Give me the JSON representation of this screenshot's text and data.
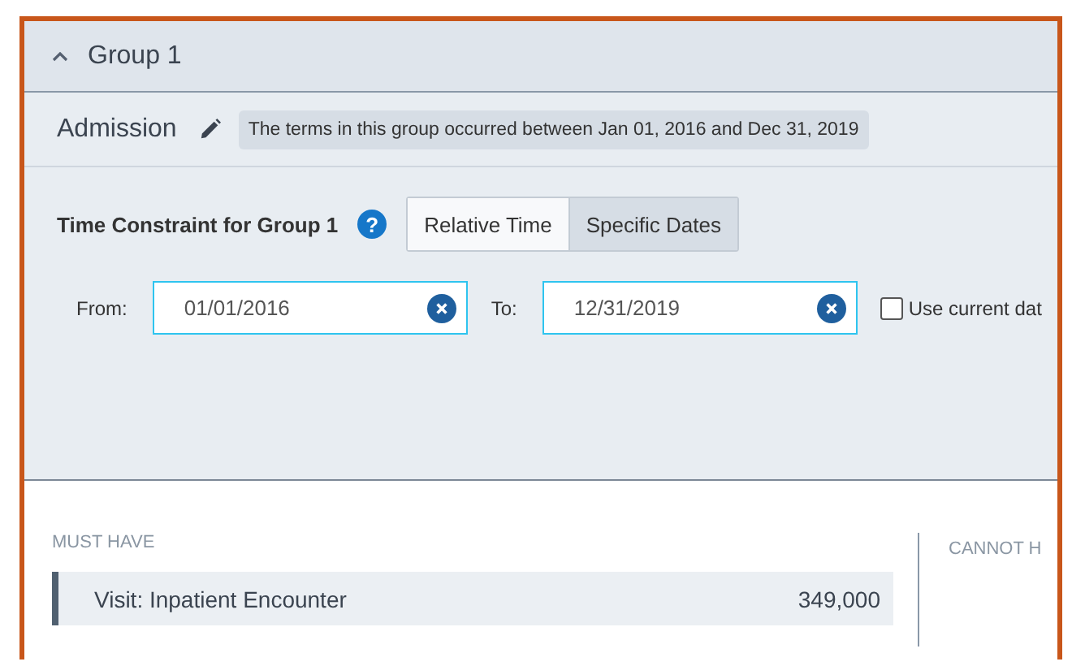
{
  "group": {
    "title": "Group 1",
    "expanded": true
  },
  "admission": {
    "label": "Admission",
    "summary": "The terms in this group occurred between Jan 01, 2016 and Dec 31, 2019"
  },
  "time_constraint": {
    "label": "Time Constraint for Group 1",
    "help": "?",
    "modes": [
      {
        "label": "Relative Time",
        "selected": false
      },
      {
        "label": "Specific Dates",
        "selected": true
      }
    ],
    "from": {
      "label": "From:",
      "value": "01/01/2016"
    },
    "to": {
      "label": "To:",
      "value": "12/31/2019"
    },
    "use_current": {
      "label": "Use current dat",
      "checked": false
    }
  },
  "must_have": {
    "title": "MUST HAVE",
    "items": [
      {
        "name": "Visit: Inpatient Encounter",
        "count": "349,000"
      }
    ]
  },
  "cannot_have": {
    "title": "CANNOT H"
  }
}
